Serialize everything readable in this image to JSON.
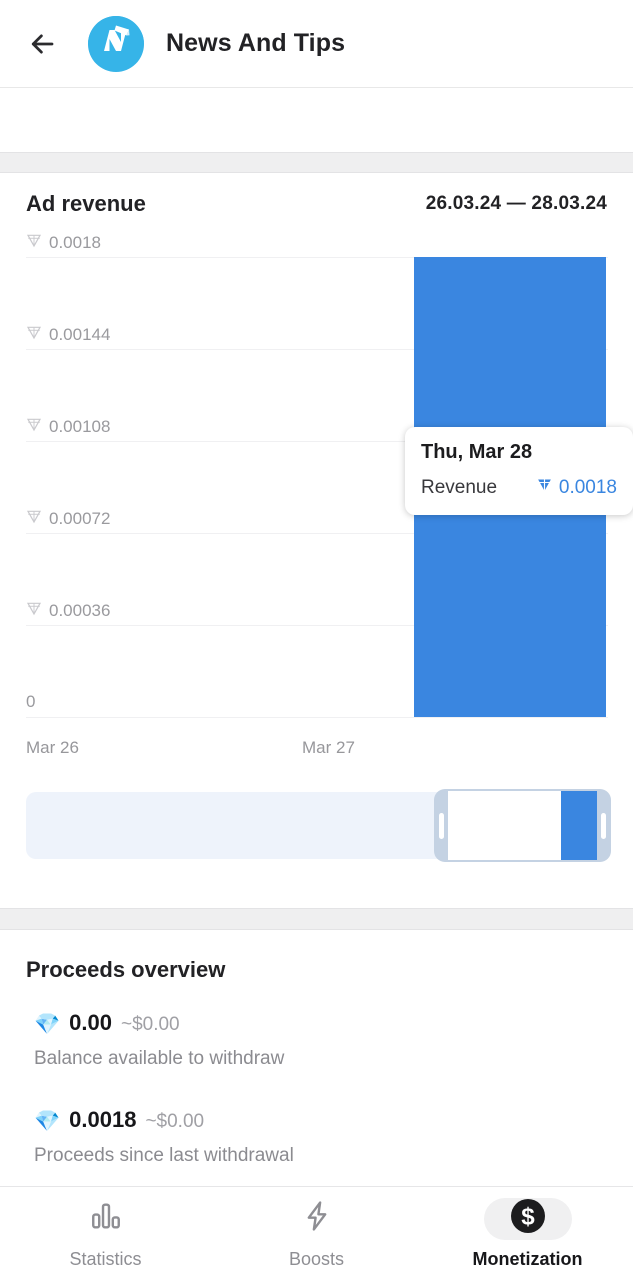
{
  "header": {
    "back_icon": "arrow-left-icon",
    "avatar_letter": "N",
    "title": "News And Tips"
  },
  "chart_card": {
    "title": "Ad revenue",
    "range": "26.03.24 — 28.03.24",
    "tooltip": {
      "date": "Thu, Mar 28",
      "metric_label": "Revenue",
      "metric_value": "0.0018",
      "currency_icon": "ton-diamond-icon"
    },
    "scrubber": {
      "left_handle": "scrub-handle-left",
      "right_handle": "scrub-handle-right"
    }
  },
  "chart_data": {
    "type": "bar",
    "title": "Ad revenue",
    "categories": [
      "Mar 26",
      "Mar 27",
      "Mar 28"
    ],
    "values": [
      0,
      0,
      0.0018
    ],
    "xlabel": "",
    "ylabel": "",
    "ylim": [
      0,
      0.0018
    ],
    "yticks": [
      "0",
      "0.00036",
      "0.00072",
      "0.00108",
      "0.00144",
      "0.0018"
    ],
    "ytick_values": [
      0,
      0.00036,
      0.00072,
      0.00108,
      0.00144,
      0.0018
    ],
    "xticks": [
      "Mar 26",
      "Mar 27"
    ],
    "grid": true,
    "legend": "none",
    "series_color": "#3a86e0",
    "currency_symbol": "TON"
  },
  "proceeds": {
    "title": "Proceeds overview",
    "items": [
      {
        "gem": "💎",
        "amount": "0.00",
        "usd": "~$0.00",
        "caption": "Balance available to withdraw"
      },
      {
        "gem": "💎",
        "amount": "0.0018",
        "usd": "~$0.00",
        "caption": "Proceeds since last withdrawal"
      }
    ]
  },
  "bottom_nav": {
    "items": [
      {
        "label": "Statistics",
        "icon": "bar-chart-icon",
        "active": false
      },
      {
        "label": "Boosts",
        "icon": "lightning-icon",
        "active": false
      },
      {
        "label": "Monetization",
        "icon": "dollar-circle-icon",
        "active": true
      }
    ]
  },
  "colors": {
    "accent": "#3a86e0",
    "avatar": "#36b4e8",
    "separator": "#efeff0",
    "muted_text": "#9a9a9e"
  }
}
